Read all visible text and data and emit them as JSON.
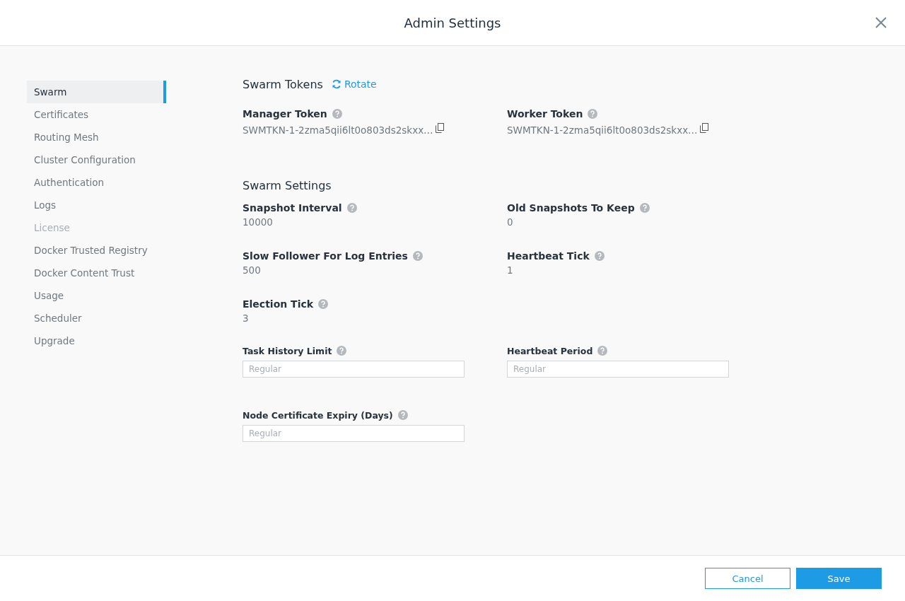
{
  "window": {
    "title": "Admin Settings"
  },
  "sidebar": {
    "items": [
      {
        "label": "Swarm",
        "selected": true,
        "disabled": false
      },
      {
        "label": "Certificates",
        "selected": false,
        "disabled": false
      },
      {
        "label": "Routing Mesh",
        "selected": false,
        "disabled": false
      },
      {
        "label": "Cluster Configuration",
        "selected": false,
        "disabled": false
      },
      {
        "label": "Authentication",
        "selected": false,
        "disabled": false
      },
      {
        "label": "Logs",
        "selected": false,
        "disabled": false
      },
      {
        "label": "License",
        "selected": false,
        "disabled": true
      },
      {
        "label": "Docker Trusted Registry",
        "selected": false,
        "disabled": false
      },
      {
        "label": "Docker Content Trust",
        "selected": false,
        "disabled": false
      },
      {
        "label": "Usage",
        "selected": false,
        "disabled": false
      },
      {
        "label": "Scheduler",
        "selected": false,
        "disabled": false
      },
      {
        "label": "Upgrade",
        "selected": false,
        "disabled": false
      }
    ]
  },
  "swarm_tokens": {
    "title": "Swarm Tokens",
    "rotate": "Rotate",
    "tokens": [
      {
        "label": "Manager Token",
        "value": "SWMTKN-1-2zma5qii6lt0o803ds2skxx…"
      },
      {
        "label": "Worker Token",
        "value": "SWMTKN-1-2zma5qii6lt0o803ds2skxx…"
      }
    ]
  },
  "swarm_settings": {
    "title": "Swarm Settings",
    "rows": [
      [
        {
          "kind": "value",
          "label": "Snapshot Interval",
          "value": "10000"
        },
        {
          "kind": "value",
          "label": "Old Snapshots To Keep",
          "value": "0"
        }
      ],
      [
        {
          "kind": "value",
          "label": "Slow Follower For Log Entries",
          "value": "500"
        },
        {
          "kind": "value",
          "label": "Heartbeat Tick",
          "value": "1"
        }
      ],
      [
        {
          "kind": "value",
          "label": "Election Tick",
          "value": "3"
        }
      ],
      [
        {
          "kind": "input",
          "label": "Task History Limit",
          "placeholder": "Regular"
        },
        {
          "kind": "input",
          "label": "Heartbeat Period",
          "placeholder": "Regular"
        }
      ],
      [
        {
          "kind": "input",
          "label": "Node Certificate Expiry (Days)",
          "placeholder": "Regular"
        }
      ]
    ]
  },
  "footer": {
    "buttons": [
      {
        "label": "Cancel",
        "kind": "secondary"
      },
      {
        "label": "Save",
        "kind": "primary"
      }
    ]
  }
}
